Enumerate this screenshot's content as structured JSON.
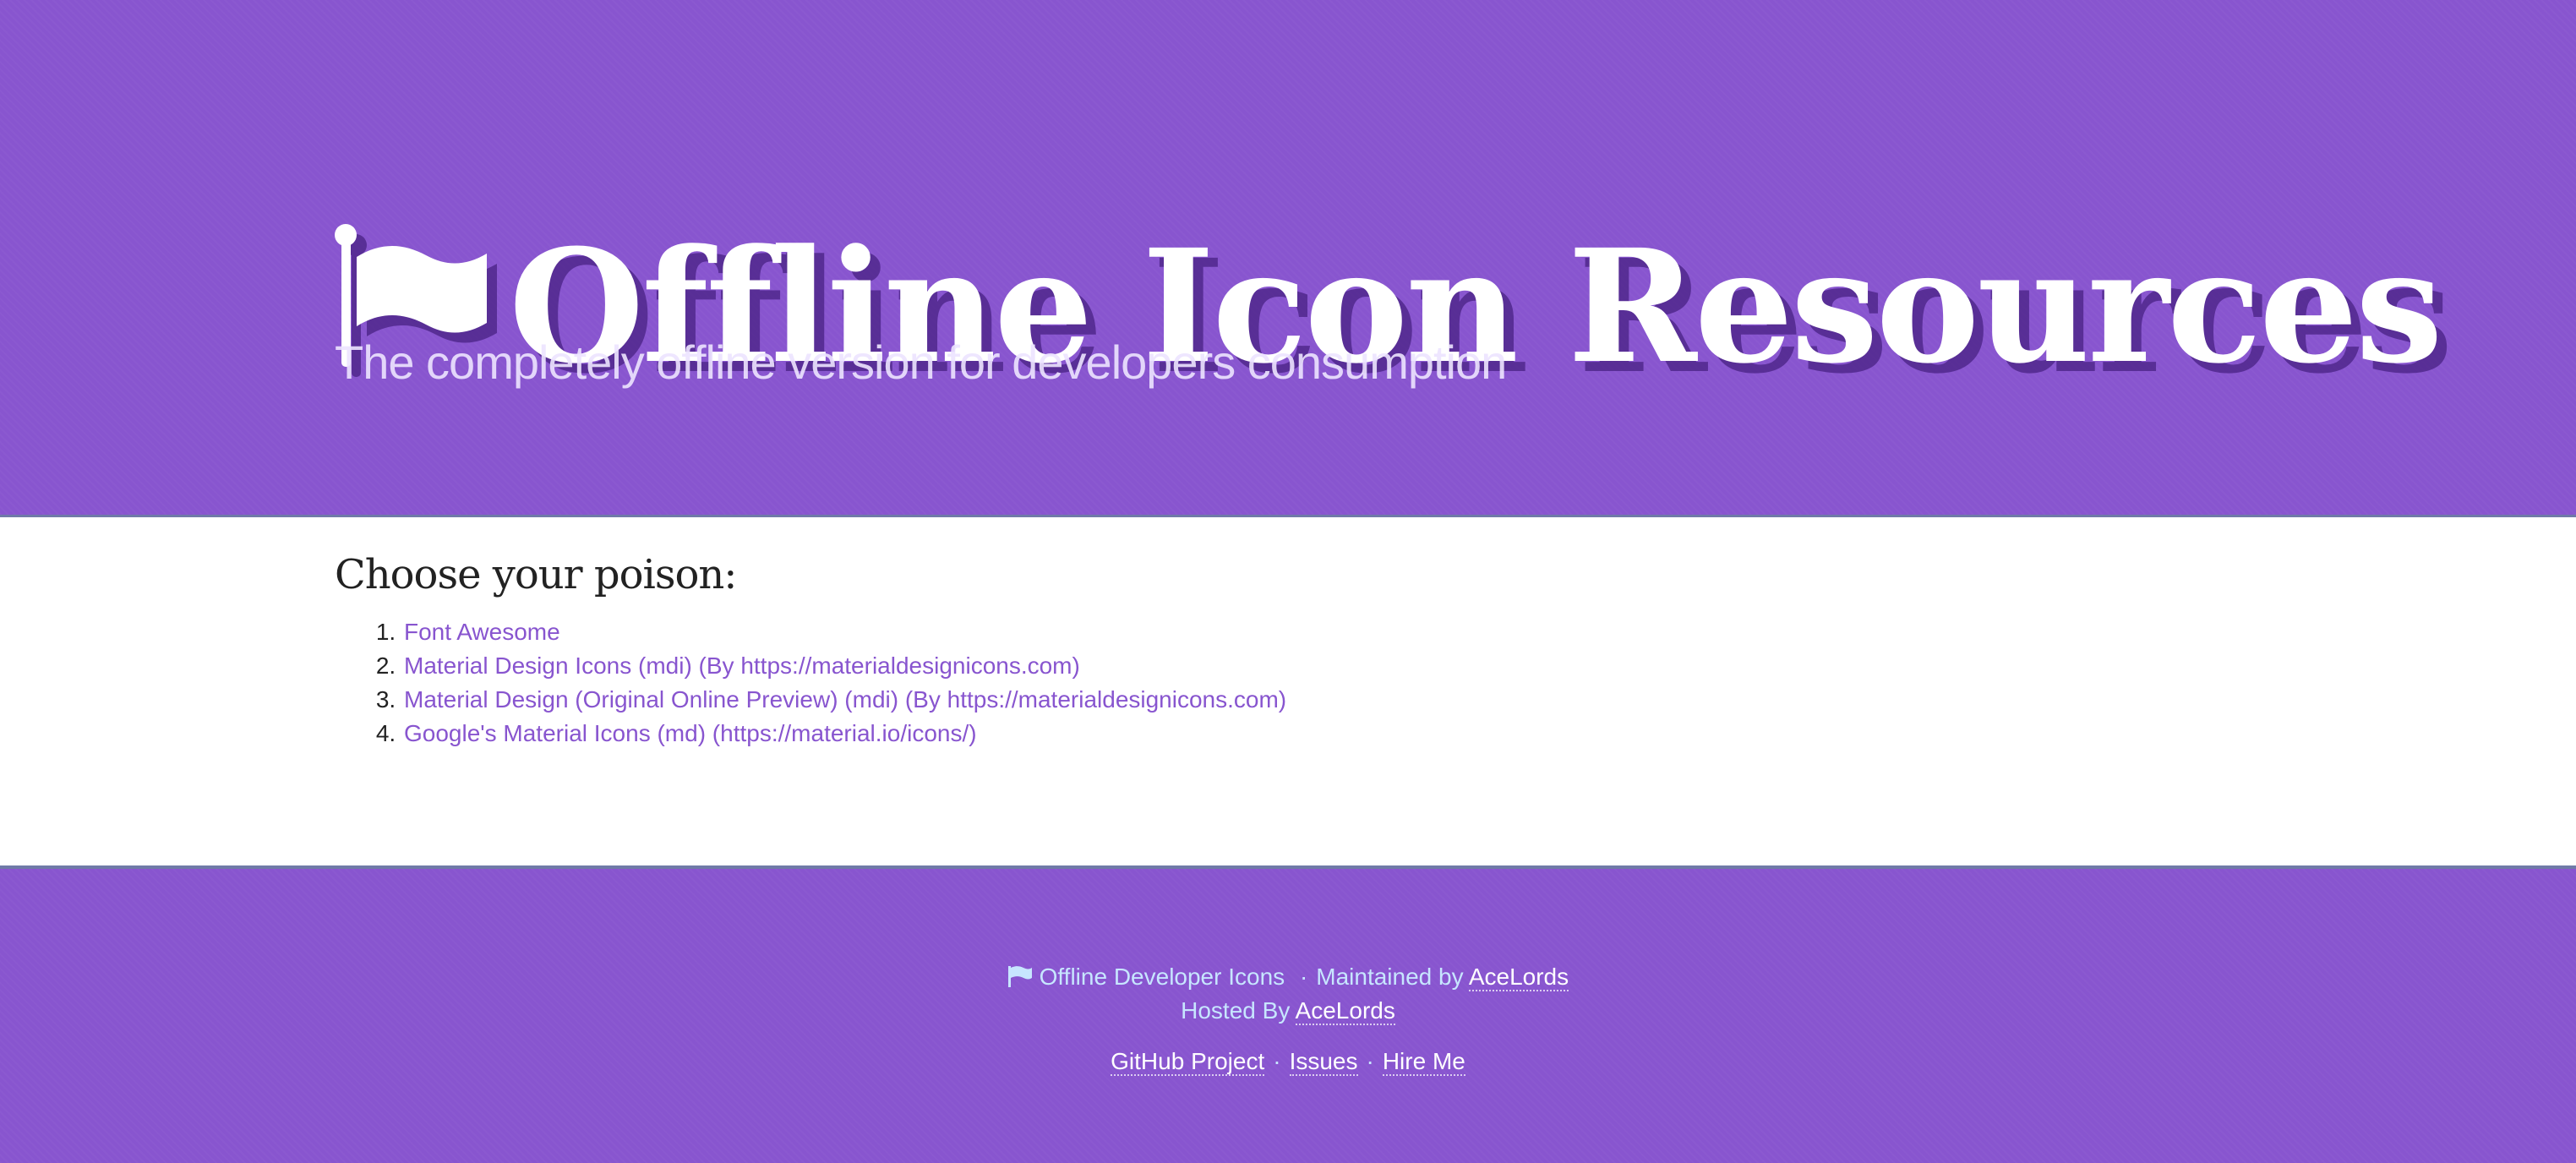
{
  "header": {
    "icon": "flag-icon",
    "title": "Offline Icon Resources",
    "subtitle": "The completely offline version for developers consumption",
    "background_color": "#8855cf"
  },
  "main": {
    "heading": "Choose your poison:",
    "resources": [
      {
        "number": "1.",
        "label": "Font Awesome"
      },
      {
        "number": "2.",
        "label": "Material Design Icons (mdi) (By https://materialdesignicons.com)"
      },
      {
        "number": "3.",
        "label": "Material Design (Original Online Preview) (mdi) (By https://materialdesignicons.com)"
      },
      {
        "number": "4.",
        "label": "Google's Material Icons (md) (https://material.io/icons/)"
      }
    ],
    "link_color": "#8855cf"
  },
  "footer": {
    "icon": "flag-icon",
    "project_name": "Offline Developer Icons",
    "separator": "·",
    "maintained_by_text": "Maintained by",
    "maintainer_link": "AceLords",
    "hosted_by_text": "Hosted By",
    "host_link": "AceLords",
    "links": [
      {
        "label": "GitHub Project"
      },
      {
        "label": "Issues"
      },
      {
        "label": "Hire Me"
      }
    ]
  }
}
